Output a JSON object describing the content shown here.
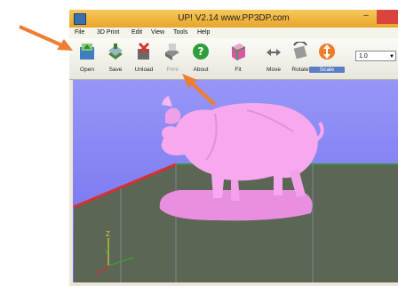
{
  "window": {
    "title": "UP!  V2.14 www.PP3DP.com"
  },
  "menu": [
    "File",
    "3D Print",
    "Edit",
    "View",
    "Tools",
    "Help"
  ],
  "toolbar": {
    "open": "Open",
    "save": "Save",
    "unload": "Unload",
    "print": "Print",
    "about": "About",
    "fit": "Fit",
    "move": "Move",
    "rotate": "Rotate",
    "scale": "Scale",
    "scale_value": "1.0"
  },
  "axes": {
    "x": "X",
    "y": "Y",
    "z": "Z"
  },
  "colors": {
    "model": "#f7a8ef",
    "platform": "#5c6655",
    "viewport": "#8280f3",
    "arrow": "#ef7d32"
  }
}
